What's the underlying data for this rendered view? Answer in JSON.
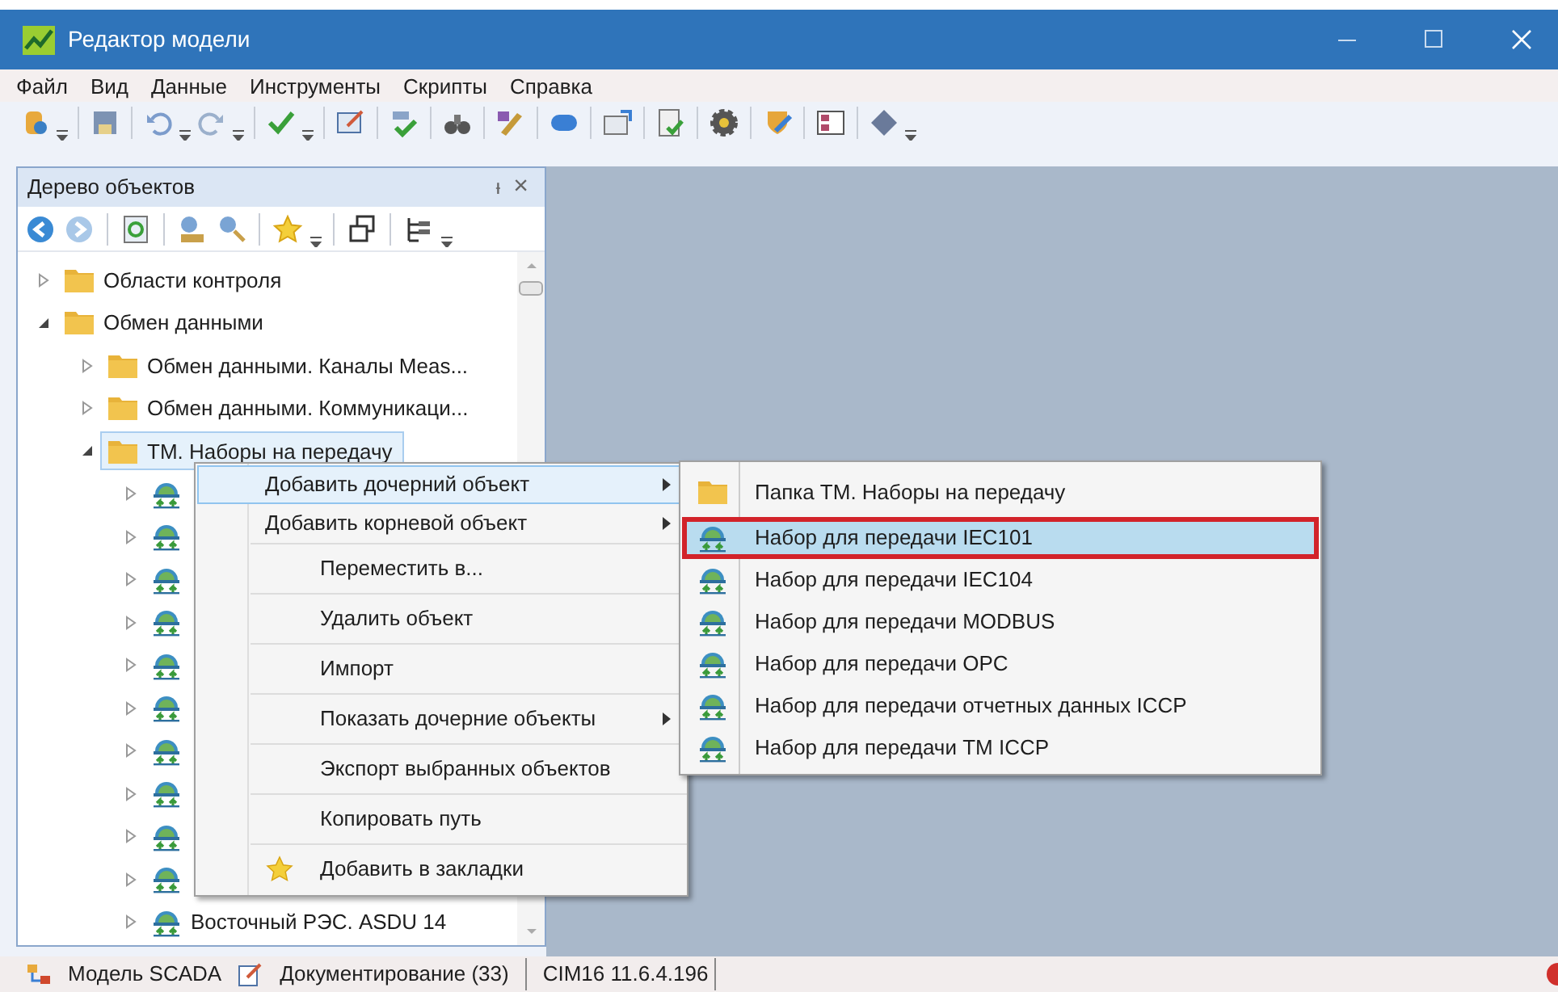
{
  "window": {
    "title": "Редактор модели"
  },
  "menu": [
    "Файл",
    "Вид",
    "Данные",
    "Инструменты",
    "Скрипты",
    "Справка"
  ],
  "panel": {
    "title": "Дерево объектов",
    "pin": "ᵻ",
    "close": "×"
  },
  "tree": [
    {
      "label": "Области контроля",
      "kind": "folder",
      "expanded": false,
      "selected": false
    },
    {
      "label": "Обмен данными",
      "kind": "folder",
      "expanded": true,
      "selected": false,
      "children": [
        {
          "label": "Обмен данными. Каналы Meas...",
          "kind": "folder",
          "expanded": false,
          "selected": false
        },
        {
          "label": "Обмен данными. Коммуникаци...",
          "kind": "folder",
          "expanded": false,
          "selected": false
        },
        {
          "label": "ТМ. Наборы на передачу",
          "kind": "folder",
          "expanded": true,
          "selected": true,
          "children": [
            {
              "kind": "set",
              "expanded": false,
              "selected": false
            },
            {
              "kind": "set",
              "expanded": false,
              "selected": false
            },
            {
              "kind": "set",
              "expanded": false,
              "selected": false
            },
            {
              "kind": "set",
              "expanded": false,
              "selected": false
            },
            {
              "kind": "set",
              "expanded": false,
              "selected": false
            },
            {
              "kind": "set",
              "expanded": false,
              "selected": false
            },
            {
              "kind": "set",
              "expanded": false,
              "selected": false
            },
            {
              "kind": "set",
              "expanded": false,
              "selected": false
            },
            {
              "kind": "set",
              "expanded": false,
              "selected": false
            },
            {
              "kind": "set",
              "expanded": false,
              "selected": false
            },
            {
              "label": "Восточный РЭС. ASDU 14",
              "kind": "set",
              "expanded": false,
              "selected": false
            }
          ]
        }
      ]
    }
  ],
  "context_menu": {
    "groups": [
      [
        {
          "label": "Добавить дочерний объект",
          "kind": "plain",
          "submenu": true,
          "selected": true
        },
        {
          "label": "Добавить корневой объект",
          "kind": "plain",
          "submenu": true,
          "selected": false
        }
      ],
      [
        {
          "label": "Переместить в...",
          "kind": "plain",
          "submenu": false,
          "selected": false
        }
      ],
      [
        {
          "label": "Удалить объект",
          "kind": "plain",
          "submenu": false,
          "selected": false
        }
      ],
      [
        {
          "label": "Импорт",
          "kind": "plain",
          "submenu": false,
          "selected": false
        }
      ],
      [
        {
          "label": "Показать дочерние объекты",
          "kind": "plain",
          "submenu": true,
          "selected": false
        }
      ],
      [
        {
          "label": "Экспорт выбранных объектов",
          "kind": "plain",
          "submenu": false,
          "selected": false
        }
      ],
      [
        {
          "label": "Копировать путь",
          "kind": "plain",
          "submenu": false,
          "selected": false
        }
      ],
      [
        {
          "label": "Добавить в закладки",
          "kind": "bookmark",
          "submenu": false,
          "selected": false
        }
      ]
    ]
  },
  "submenu": [
    {
      "label": "Папка ТМ. Наборы на передачу",
      "kind": "folder",
      "selected": false
    },
    {
      "label": "Набор для передачи IEC101",
      "kind": "set",
      "selected": true
    },
    {
      "label": "Набор для передачи IEC104",
      "kind": "set",
      "selected": false
    },
    {
      "label": "Набор для передачи MODBUS",
      "kind": "set",
      "selected": false
    },
    {
      "label": "Набор для передачи OPC",
      "kind": "set",
      "selected": false
    },
    {
      "label": "Набор для передачи отчетных данных ICCP",
      "kind": "set",
      "selected": false
    },
    {
      "label": "Набор для передачи TM ICCP",
      "kind": "set",
      "selected": false
    }
  ],
  "status_bar": [
    {
      "label": "Модель SCADA",
      "kind": "model"
    },
    {
      "label": "Документирование (33)",
      "kind": "doc"
    },
    {
      "label": "CIM16 11.6.4.196",
      "kind": "plain"
    }
  ]
}
